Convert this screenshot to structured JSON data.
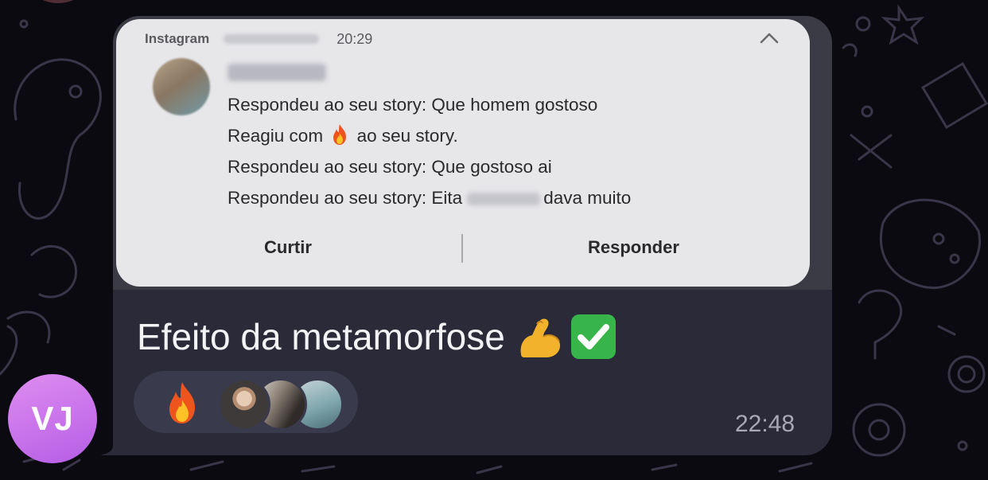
{
  "notification": {
    "app_name": "Instagram",
    "time": "20:29",
    "lines": [
      "Respondeu ao seu story: Que homem gostoso",
      "Reagiu com",
      "ao seu story.",
      "Respondeu ao seu story: Que gostoso ai",
      "Respondeu ao seu story: Eita",
      "dava muito"
    ],
    "action_like": "Curtir",
    "action_reply": "Responder"
  },
  "message": {
    "sender_initials": "VJ",
    "caption": "Efeito da metamorfose",
    "time": "22:48",
    "reaction": "fire"
  },
  "colors": {
    "bubble": "#2a2a38",
    "avatar": "#c774ec",
    "notification_bg": "#e7e7ea"
  }
}
